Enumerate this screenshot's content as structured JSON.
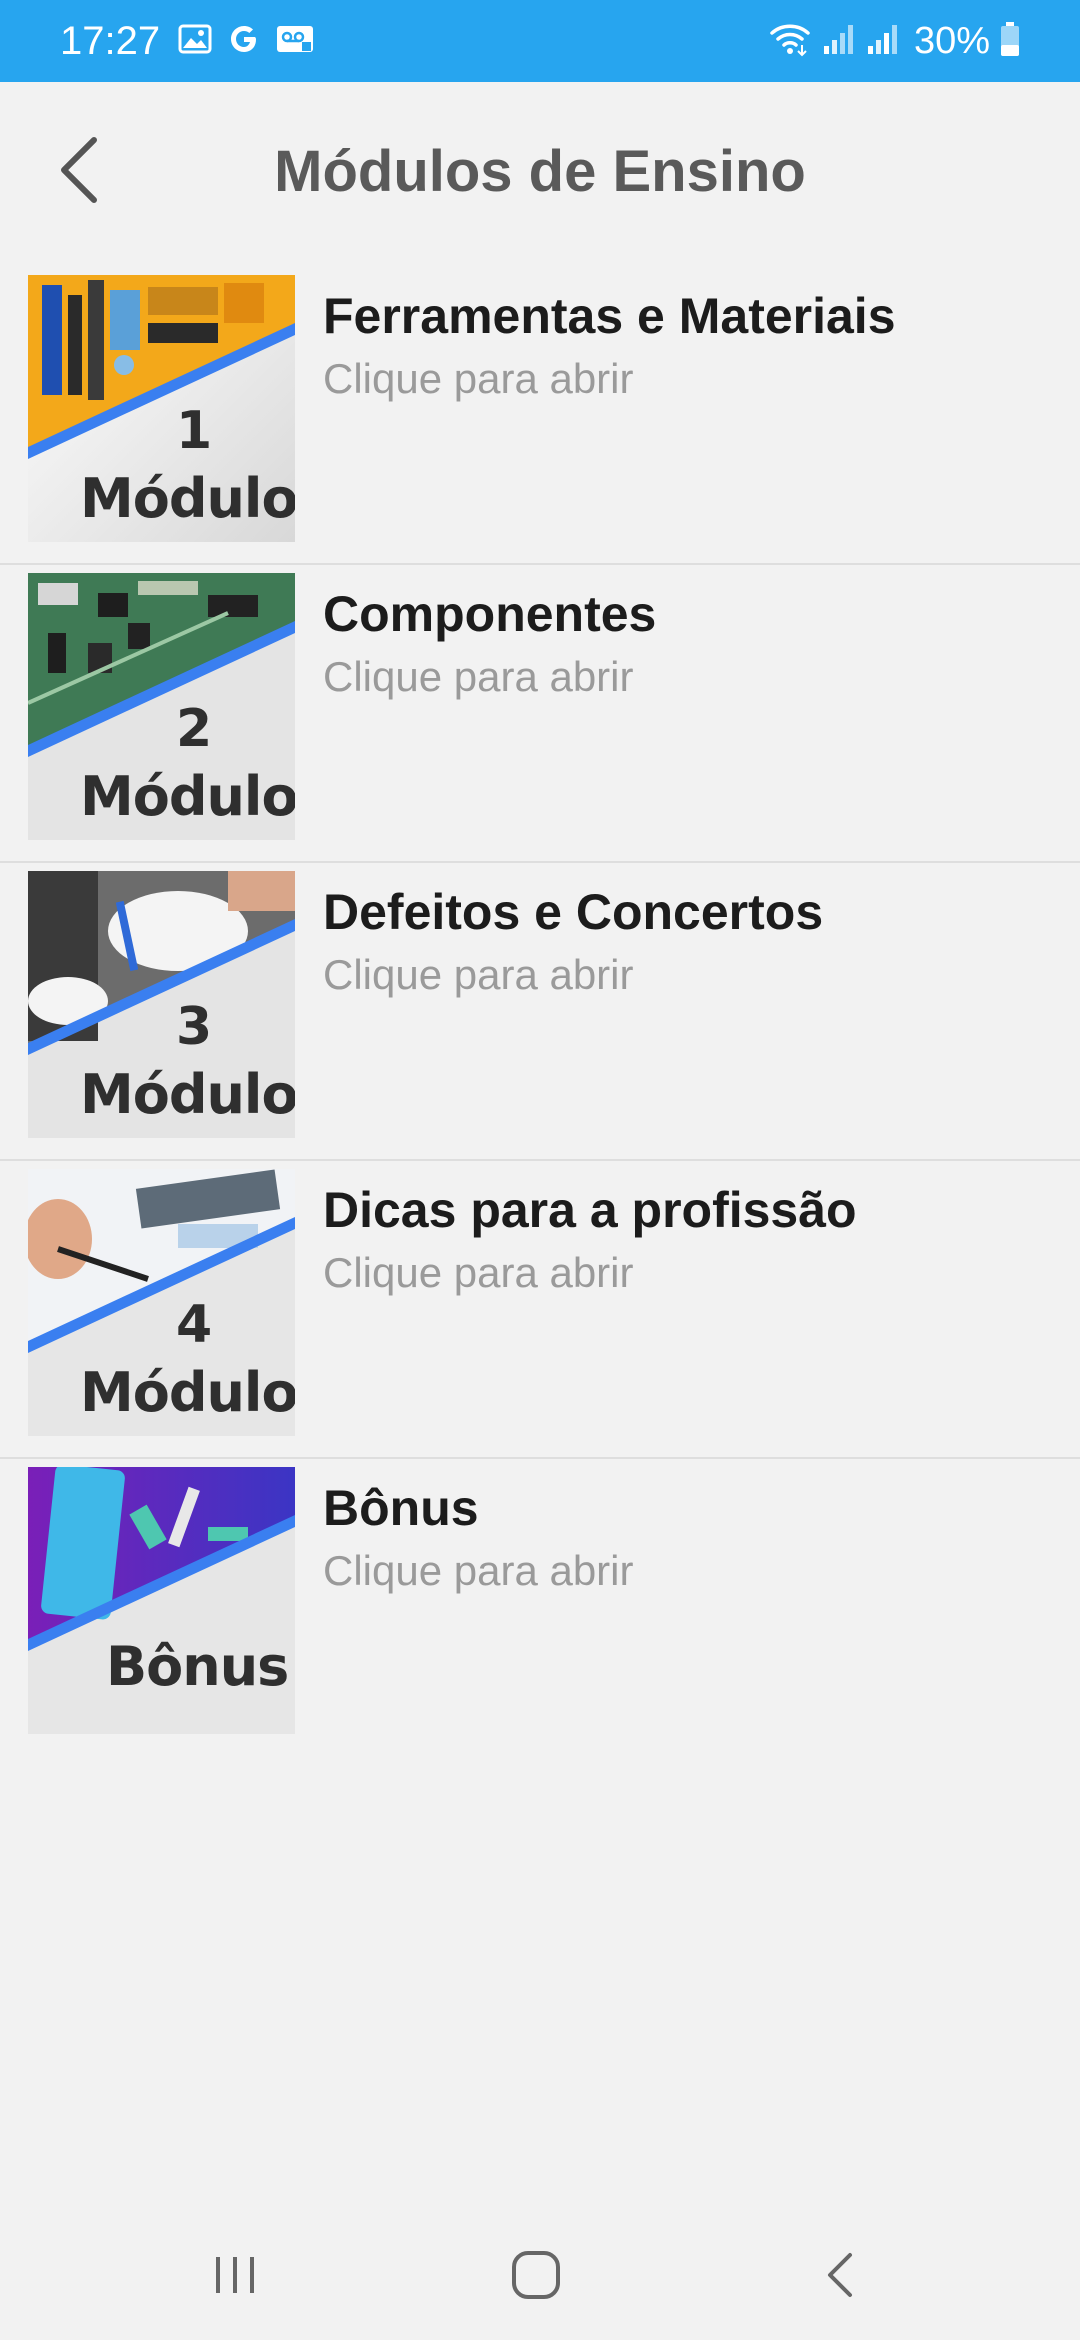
{
  "status_bar": {
    "time": "17:27",
    "battery": "30%",
    "icons": [
      "gallery-icon",
      "google-icon",
      "voicemail-icon",
      "wifi-icon",
      "signal-icon",
      "signal-icon",
      "battery-icon"
    ],
    "background": "#27a5ef"
  },
  "header": {
    "title": "Módulos de Ensino",
    "back_icon": "chevron-left-icon"
  },
  "modules": [
    {
      "title": "Ferramentas e Materiais",
      "subtitle": "Clique para abrir",
      "thumb_number": "1",
      "thumb_word": "Módulo"
    },
    {
      "title": "Componentes",
      "subtitle": "Clique para abrir",
      "thumb_number": "2",
      "thumb_word": "Módulo"
    },
    {
      "title": "Defeitos e Concertos",
      "subtitle": "Clique para abrir",
      "thumb_number": "3",
      "thumb_word": "Módulo"
    },
    {
      "title": "Dicas para a profissão",
      "subtitle": "Clique para abrir",
      "thumb_number": "4",
      "thumb_word": "Módulo"
    },
    {
      "title": "Bônus",
      "subtitle": "Clique para abrir",
      "thumb_word": "Bônus"
    }
  ],
  "nav_bar": {
    "icons": [
      "recent-apps-icon",
      "home-icon",
      "back-icon"
    ]
  },
  "colors": {
    "accent_blue": "#27a5ef",
    "thumb_stripe": "#3a7ff0",
    "title_text": "#1c1c1c",
    "subtitle_text": "#9a9a9a"
  }
}
